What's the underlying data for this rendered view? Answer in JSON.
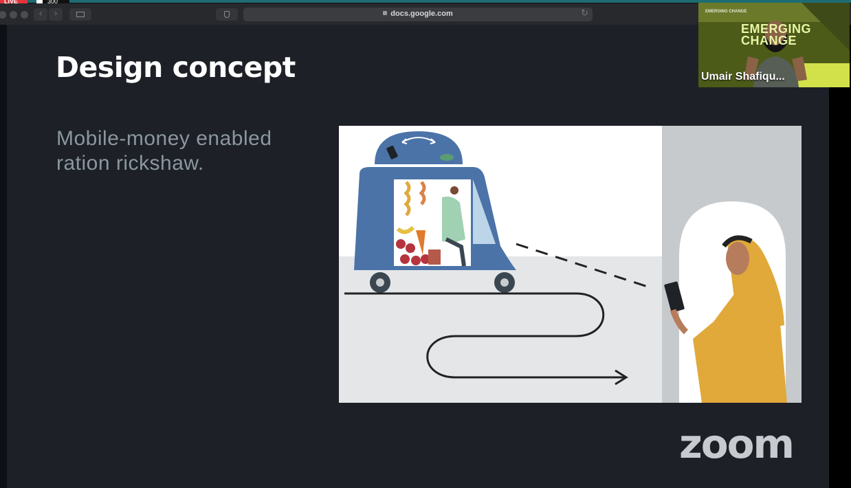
{
  "stream": {
    "live_label": "LIVE",
    "viewers": "300"
  },
  "browser": {
    "url": "docs.google.com",
    "back_glyph": "‹",
    "forward_glyph": "›",
    "reload_glyph": "↻"
  },
  "slide": {
    "title": "Design concept",
    "subtitle": "Mobile-money enabled ration rickshaw.",
    "brand": "zoom"
  },
  "participant": {
    "name": "Umair Shafiqu...",
    "background_text_small": "EMERGING CHANGE",
    "background_text": "EMERGING CHANGE"
  },
  "colors": {
    "slide_bg": "#1d2026",
    "rickshaw_blue": "#4b73a8",
    "scarf_yellow": "#e0a93a",
    "live_red": "#e5343b"
  }
}
